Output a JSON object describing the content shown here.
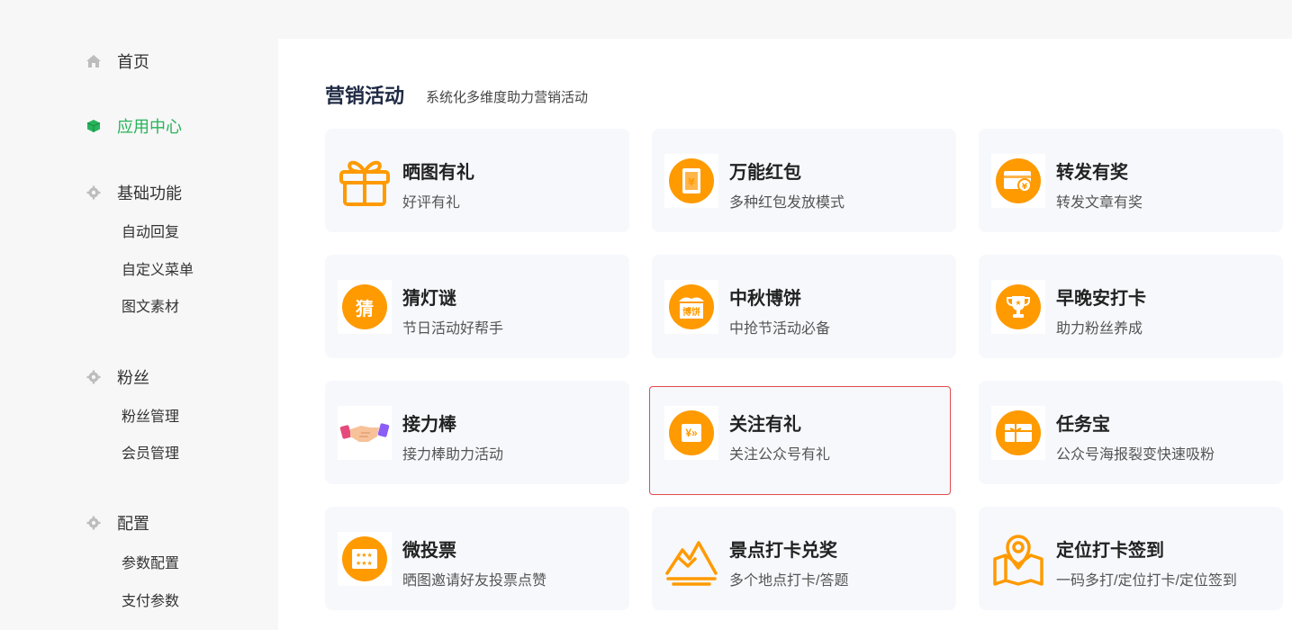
{
  "sidebar": {
    "home": {
      "label": "首页",
      "icon": "home-icon"
    },
    "app_center": {
      "label": "应用中心",
      "icon": "cube-icon",
      "active": true
    },
    "basic": {
      "label": "基础功能",
      "icon": "gear-icon",
      "items": [
        "自动回复",
        "自定义菜单",
        "图文素材"
      ]
    },
    "fans": {
      "label": "粉丝",
      "icon": "gear-icon",
      "items": [
        "粉丝管理",
        "会员管理"
      ]
    },
    "config": {
      "label": "配置",
      "icon": "gear-icon",
      "items": [
        "参数配置",
        "支付参数"
      ]
    }
  },
  "main": {
    "title": "营销活动",
    "subtitle": "系统化多维度助力营销活动",
    "cards": [
      {
        "name": "晒图有礼",
        "desc": "好评有礼",
        "icon": "gift-icon"
      },
      {
        "name": "万能红包",
        "desc": "多种红包发放模式",
        "icon": "red-envelope-icon"
      },
      {
        "name": "转发有奖",
        "desc": "转发文章有奖",
        "icon": "card-coin-icon"
      },
      {
        "name": "猜灯谜",
        "desc": "节日活动好帮手",
        "icon": "guess-icon",
        "glyph": "猜"
      },
      {
        "name": "中秋博饼",
        "desc": "中抢节活动必备",
        "icon": "bobing-icon",
        "glyph": "博饼"
      },
      {
        "name": "早晚安打卡",
        "desc": "助力粉丝养成",
        "icon": "trophy-icon"
      },
      {
        "name": "接力棒",
        "desc": "接力棒助力活动",
        "icon": "handshake-icon"
      },
      {
        "name": "关注有礼",
        "desc": "关注公众号有礼",
        "icon": "follow-gift-icon",
        "glyph": "¥»",
        "selected": true
      },
      {
        "name": "任务宝",
        "desc": "公众号海报裂变快速吸粉",
        "icon": "task-gift-icon"
      },
      {
        "name": "微投票",
        "desc": "晒图邀请好友投票点赞",
        "icon": "vote-icon"
      },
      {
        "name": "景点打卡兑奖",
        "desc": "多个地点打卡/答题",
        "icon": "mountain-icon"
      },
      {
        "name": "定位打卡签到",
        "desc": "一码多打/定位打卡/定位签到",
        "icon": "location-map-icon"
      }
    ]
  },
  "colors": {
    "accent": "#27b35a",
    "icon_orange": "#ff9a00",
    "selected_border": "#e24b4b"
  }
}
